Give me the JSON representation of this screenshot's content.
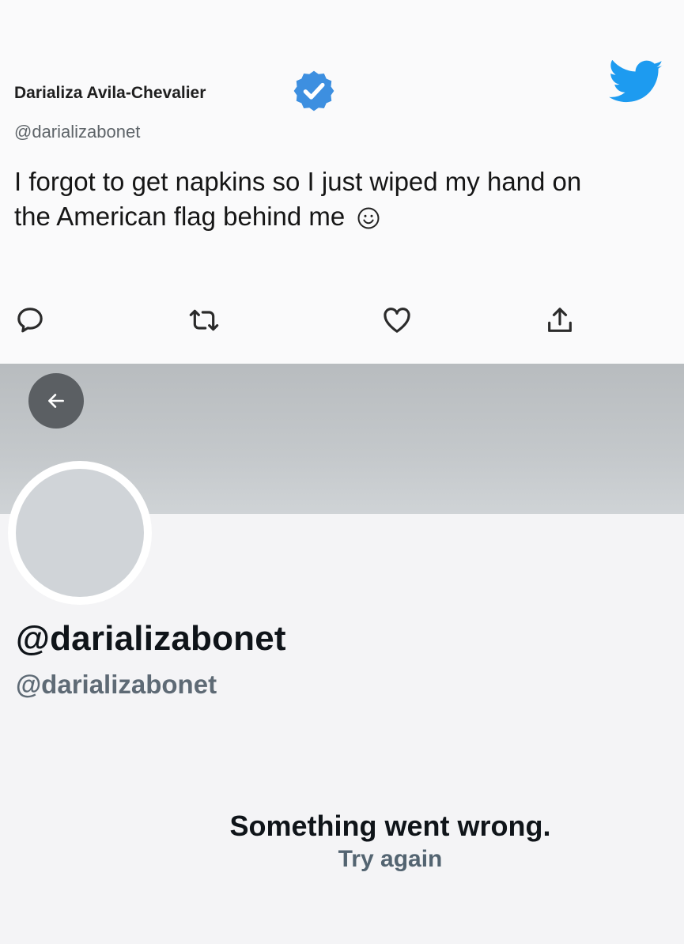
{
  "tweet": {
    "author_name": "Darializa Avila-Chevalier",
    "handle": "@darializabonet",
    "text": "I forgot to get napkins so I just wiped my hand on the American flag behind me",
    "emoji": "smiley",
    "colors": {
      "brand": "#1d9bf0",
      "verified": "#3d8fe0"
    }
  },
  "profile": {
    "display_name": "@darializabonet",
    "handle": "@darializabonet",
    "error_message": "Something went wrong.",
    "retry_label": "Try again"
  }
}
